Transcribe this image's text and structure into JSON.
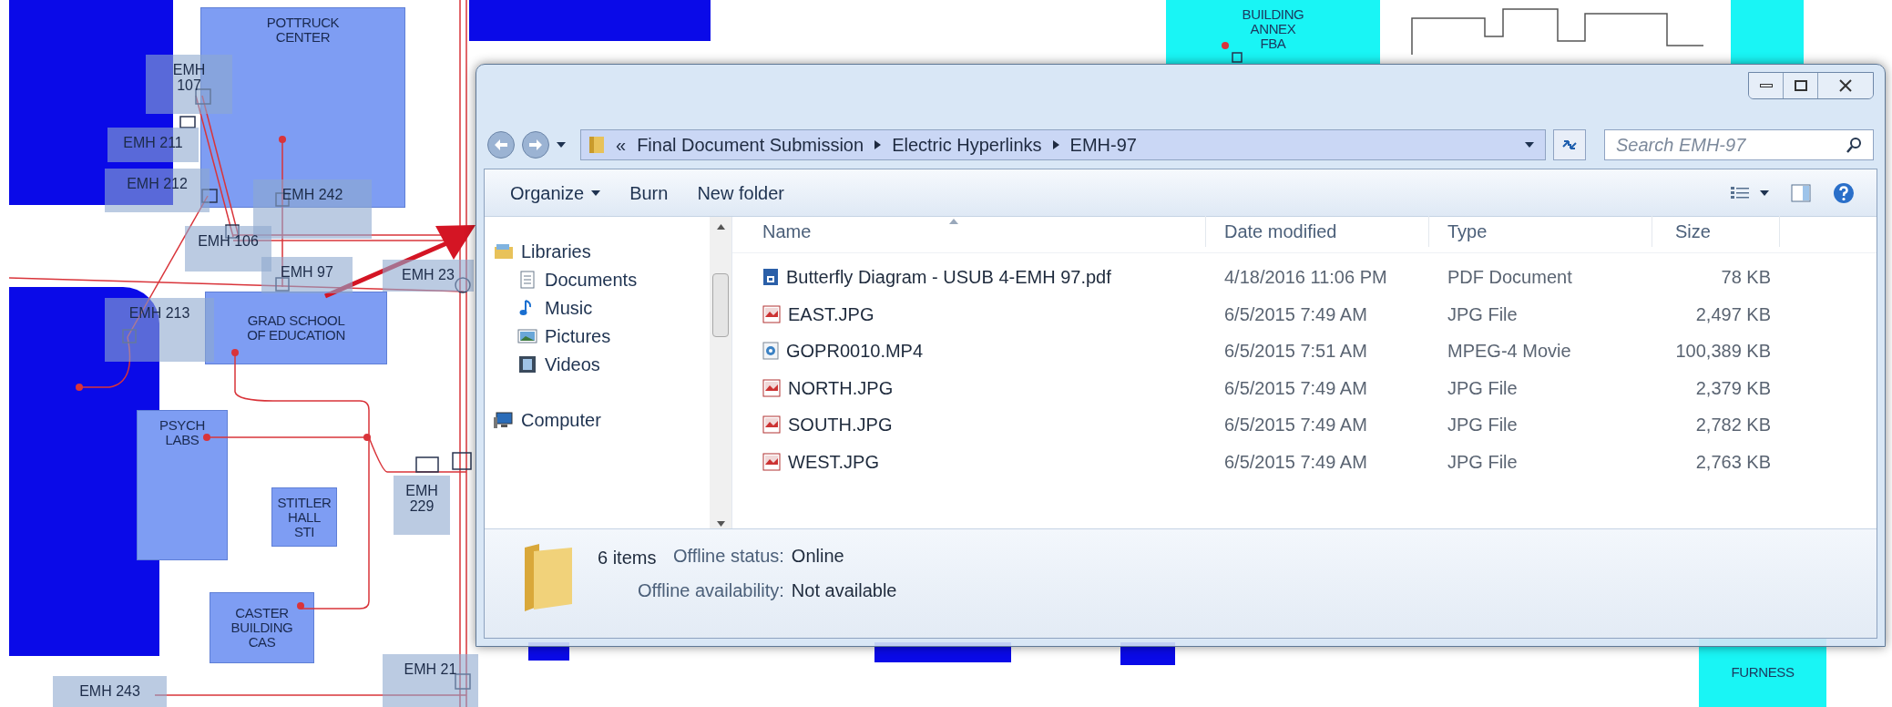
{
  "map": {
    "buildings": [
      {
        "lines": [
          "POTTRUCK",
          "CENTER"
        ],
        "kind": "building"
      },
      {
        "lines": [
          "GRAD SCHOOL",
          "OF EDUCATION"
        ],
        "kind": "building"
      },
      {
        "lines": [
          "PSYCH",
          "LABS"
        ],
        "kind": "building"
      },
      {
        "lines": [
          "STITLER",
          "HALL",
          "STI"
        ],
        "kind": "building"
      },
      {
        "lines": [
          "CASTER",
          "BUILDING",
          "CAS"
        ],
        "kind": "building"
      },
      {
        "lines": [
          "BUILDING",
          "ANNEX",
          "FBA"
        ],
        "kind": "annex"
      },
      {
        "lines": [
          "FURNESS"
        ],
        "kind": "annex"
      }
    ],
    "vaults": [
      {
        "lines": [
          "EMH",
          "107"
        ]
      },
      {
        "lines": [
          "EMH 211"
        ]
      },
      {
        "lines": [
          "EMH 212"
        ]
      },
      {
        "lines": [
          "EMH 242"
        ]
      },
      {
        "lines": [
          "EMH 106"
        ]
      },
      {
        "lines": [
          "EMH 97"
        ]
      },
      {
        "lines": [
          "EMH 23"
        ]
      },
      {
        "lines": [
          "EMH 213"
        ]
      },
      {
        "lines": [
          "EMH",
          "229"
        ]
      },
      {
        "lines": [
          "EMH 21"
        ]
      },
      {
        "lines": [
          "EMH 243"
        ]
      }
    ]
  },
  "explorer": {
    "overflow_mark": "«",
    "breadcrumb": [
      "Final Document Submission",
      "Electric Hyperlinks",
      "EMH-97"
    ],
    "search_placeholder": "Search EMH-97",
    "toolbar": [
      {
        "label": "Organize",
        "dropdown": true
      },
      {
        "label": "Burn",
        "dropdown": false
      },
      {
        "label": "New folder",
        "dropdown": false
      }
    ],
    "nav": [
      {
        "label": "Libraries",
        "kind": "libraries",
        "children": [
          {
            "label": "Documents",
            "kind": "documents"
          },
          {
            "label": "Music",
            "kind": "music"
          },
          {
            "label": "Pictures",
            "kind": "pictures"
          },
          {
            "label": "Videos",
            "kind": "videos"
          }
        ]
      },
      {
        "label": "Computer",
        "kind": "computer"
      }
    ],
    "columns": [
      "Name",
      "Date modified",
      "Type",
      "Size"
    ],
    "files": [
      {
        "name": "Butterfly Diagram - USUB 4-EMH 97.pdf",
        "date": "4/18/2016 11:06 PM",
        "type": "PDF Document",
        "size": "78 KB",
        "kind": "pdf"
      },
      {
        "name": "EAST.JPG",
        "date": "6/5/2015 7:49 AM",
        "type": "JPG File",
        "size": "2,497 KB",
        "kind": "image"
      },
      {
        "name": "GOPR0010.MP4",
        "date": "6/5/2015 7:51 AM",
        "type": "MPEG-4 Movie",
        "size": "100,389 KB",
        "kind": "video"
      },
      {
        "name": "NORTH.JPG",
        "date": "6/5/2015 7:49 AM",
        "type": "JPG File",
        "size": "2,379 KB",
        "kind": "image"
      },
      {
        "name": "SOUTH.JPG",
        "date": "6/5/2015 7:49 AM",
        "type": "JPG File",
        "size": "2,782 KB",
        "kind": "image"
      },
      {
        "name": "WEST.JPG",
        "date": "6/5/2015 7:49 AM",
        "type": "JPG File",
        "size": "2,763 KB",
        "kind": "image"
      }
    ],
    "status": {
      "count": "6 items",
      "fields": [
        {
          "label": "Offline status:",
          "value": "Online"
        },
        {
          "label": "Offline availability:",
          "value": "Not available"
        }
      ]
    }
  }
}
